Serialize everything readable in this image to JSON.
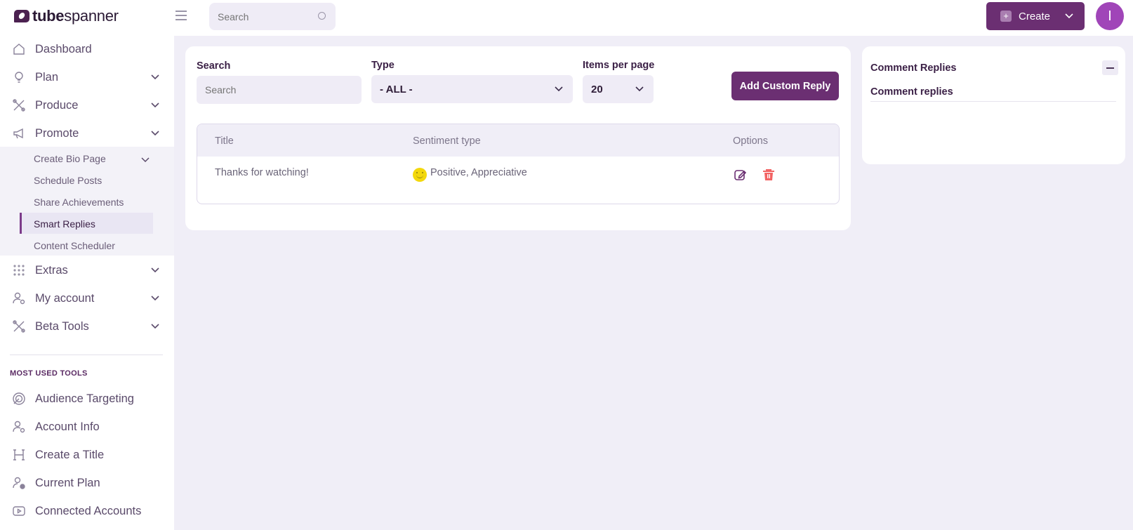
{
  "app": {
    "brand_bold": "tube",
    "brand_rest": "spanner",
    "accent_color": "#6b2f72",
    "avatar_initial": "I"
  },
  "topbar": {
    "search_placeholder": "Search",
    "create_label": "Create"
  },
  "sidebar": {
    "items": [
      {
        "label": "Dashboard",
        "icon": "home-icon"
      },
      {
        "label": "Plan",
        "icon": "lightbulb-icon"
      },
      {
        "label": "Produce",
        "icon": "tools-icon"
      },
      {
        "label": "Promote",
        "icon": "megaphone-icon"
      }
    ],
    "promote_sub": [
      {
        "label": "Create Bio Page"
      },
      {
        "label": "Schedule Posts"
      },
      {
        "label": "Share Achievements"
      },
      {
        "label": "Smart Replies",
        "active": true
      },
      {
        "label": "Content Scheduler"
      }
    ],
    "items_after": [
      {
        "label": "Extras",
        "icon": "grid-dots-icon"
      },
      {
        "label": "My account",
        "icon": "user-gear-icon"
      },
      {
        "label": "Beta Tools",
        "icon": "tools-icon"
      }
    ],
    "section_label": "MOST USED TOOLS",
    "most_used": [
      {
        "label": "Audience Targeting",
        "icon": "target-icon"
      },
      {
        "label": "Account Info",
        "icon": "user-gear-icon"
      },
      {
        "label": "Create a Title",
        "icon": "heading-icon"
      },
      {
        "label": "Current Plan",
        "icon": "user-info-icon"
      },
      {
        "label": "Connected Accounts",
        "icon": "youtube-icon"
      }
    ]
  },
  "filters": {
    "search_label": "Search",
    "search_placeholder": "Search",
    "type_label": "Type",
    "type_value": "- ALL -",
    "items_label": "Items per page",
    "items_value": "20",
    "add_button": "Add Custom Reply"
  },
  "table": {
    "headers": [
      "Title",
      "Sentiment type",
      "Options"
    ],
    "rows": [
      {
        "title": "Thanks for watching!",
        "sentiment": "Positive, Appreciative"
      }
    ]
  },
  "right_panel": {
    "title": "Comment Replies",
    "subtitle": "Comment replies"
  }
}
